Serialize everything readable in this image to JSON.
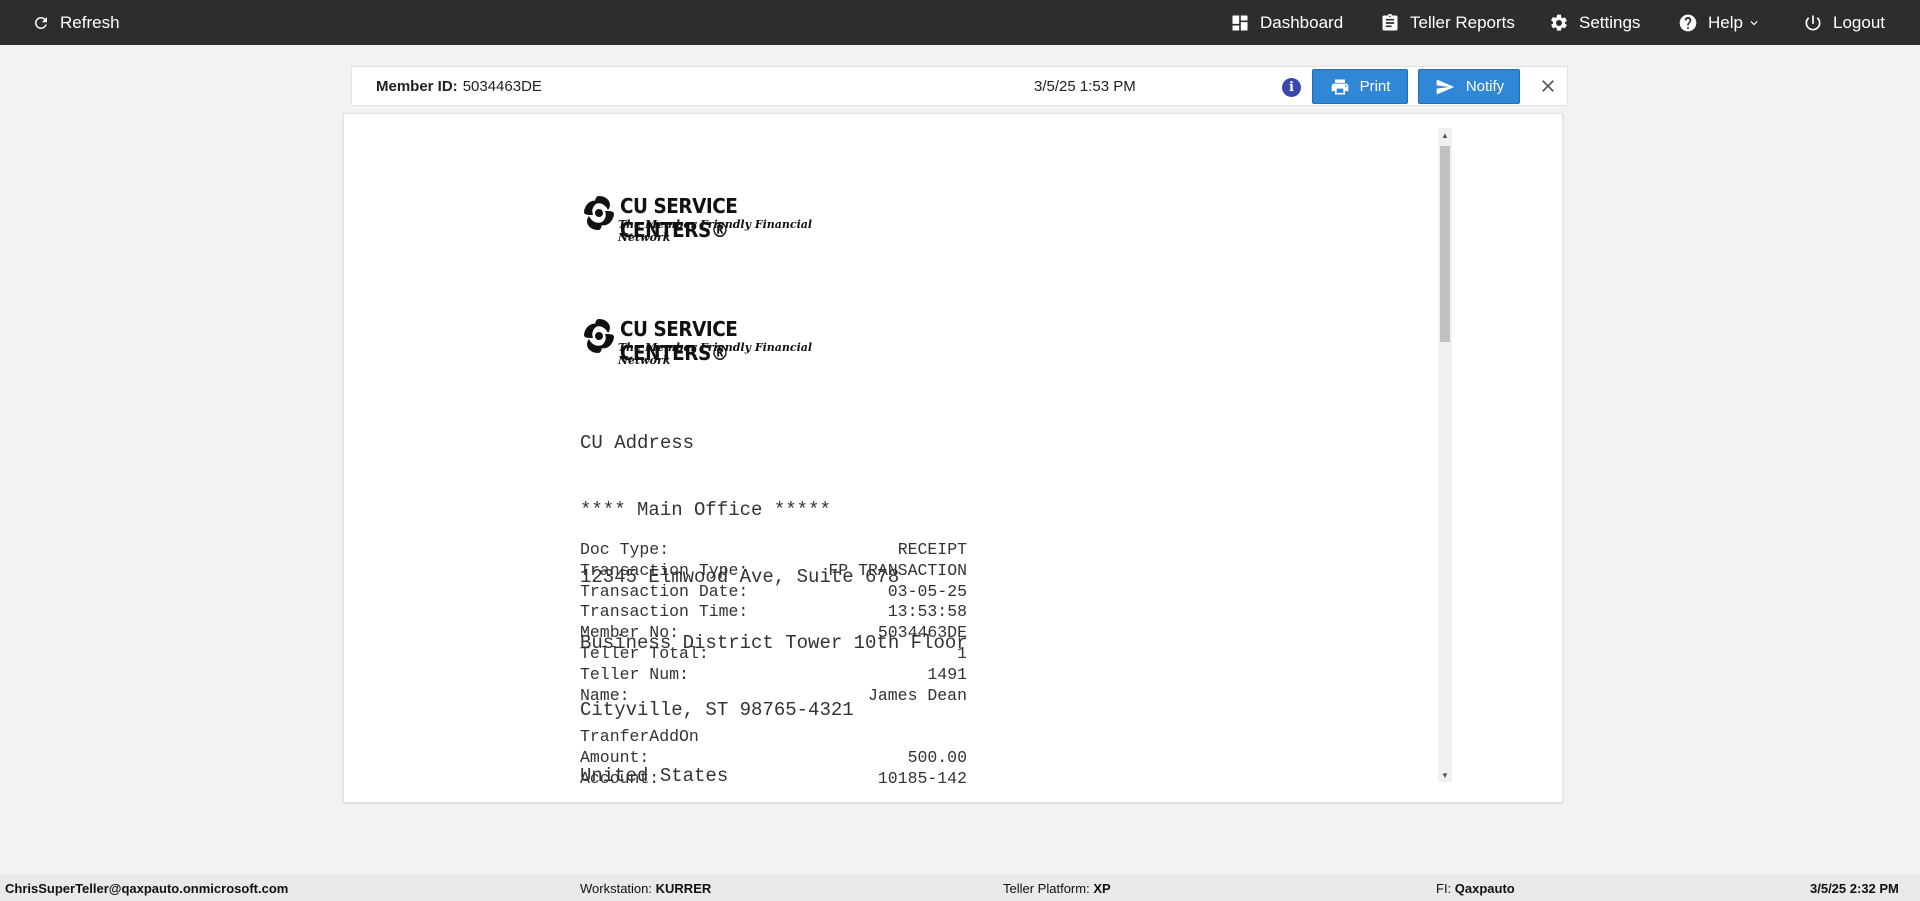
{
  "topbar": {
    "refresh_label": "Refresh",
    "nav": {
      "dashboard": "Dashboard",
      "teller_reports": "Teller Reports",
      "settings": "Settings",
      "help": "Help",
      "logout": "Logout"
    }
  },
  "header": {
    "member_id_label": "Member ID:",
    "member_id_value": "5034463DE",
    "datetime": "3/5/25 1:53 PM",
    "print_label": "Print",
    "notify_label": "Notify"
  },
  "receipt": {
    "logo": {
      "name": "CU SERVICE CENTERS®",
      "tagline": "The Member Friendly Financial Network"
    },
    "address_lines": [
      "CU Address",
      "**** Main Office *****",
      "12345 Elmwood Ave, Suite 678",
      "Business District Tower 10th Floor",
      "Cityville, ST 98765-4321",
      "United States"
    ],
    "details": [
      {
        "label": "Doc Type:",
        "value": "RECEIPT"
      },
      {
        "label": "Transaction Type:",
        "value": "FP TRANSACTION"
      },
      {
        "label": "Transaction Date:",
        "value": "03-05-25"
      },
      {
        "label": "Transaction Time:",
        "value": "13:53:58"
      },
      {
        "label": "Member No:",
        "value": "5034463DE"
      },
      {
        "label": "Teller Total:",
        "value": "1"
      },
      {
        "label": "Teller Num:",
        "value": "1491"
      },
      {
        "label": "Name:",
        "value": "James Dean"
      }
    ],
    "section_title": "TranferAddOn",
    "section_rows": [
      {
        "label": "Amount:",
        "value": "500.00"
      },
      {
        "label": "Account:",
        "value": "10185-142"
      }
    ]
  },
  "statusbar": {
    "user": "ChrisSuperTeller@qaxpauto.onmicrosoft.com",
    "workstation_label": "Workstation:",
    "workstation_value": "KURRER",
    "platform_label": "Teller Platform:",
    "platform_value": "XP",
    "fi_label": "FI:",
    "fi_value": "Qaxpauto",
    "datetime": "3/5/25 2:32 PM"
  },
  "colors": {
    "topbar_bg": "#2d2d2d",
    "button_blue": "#2f87d6",
    "info_icon": "#3949ab",
    "page_bg": "#f2f2f2"
  }
}
